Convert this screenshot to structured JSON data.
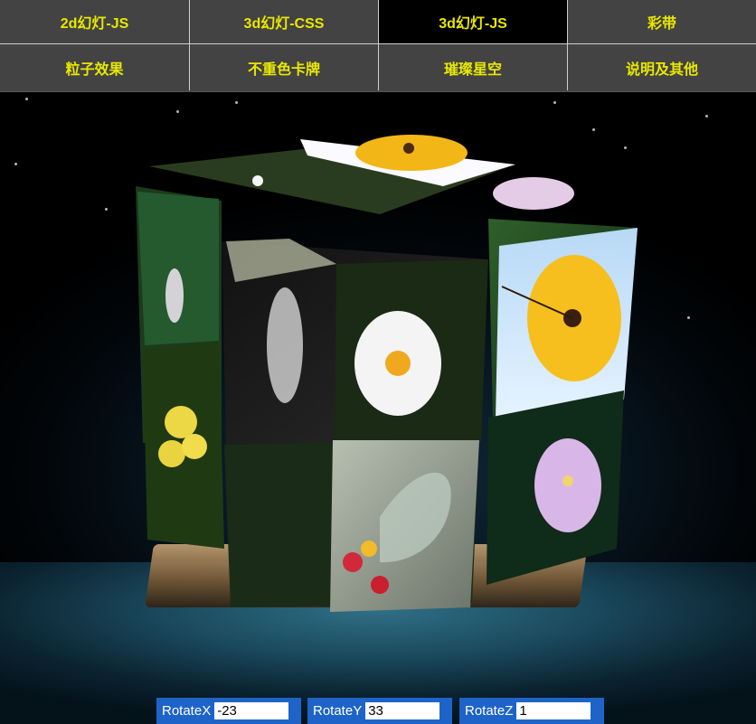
{
  "nav": {
    "items": [
      {
        "label": "2d幻灯-JS",
        "active": false
      },
      {
        "label": "3d幻灯-CSS",
        "active": false
      },
      {
        "label": "3d幻灯-JS",
        "active": true
      },
      {
        "label": "彩带",
        "active": false
      },
      {
        "label": "粒子效果",
        "active": false
      },
      {
        "label": "不重色卡牌",
        "active": false
      },
      {
        "label": "璀璨星空",
        "active": false
      },
      {
        "label": "说明及其他",
        "active": false
      }
    ],
    "text_color": "#e9e800",
    "bg_color": "#434343",
    "active_bg": "#000000"
  },
  "controls": {
    "rotate_x": {
      "label": "RotateX",
      "value": "-23"
    },
    "rotate_y": {
      "label": "RotateY",
      "value": "33"
    },
    "rotate_z": {
      "label": "RotateZ",
      "value": "1"
    },
    "accent": "#1e64c8"
  }
}
